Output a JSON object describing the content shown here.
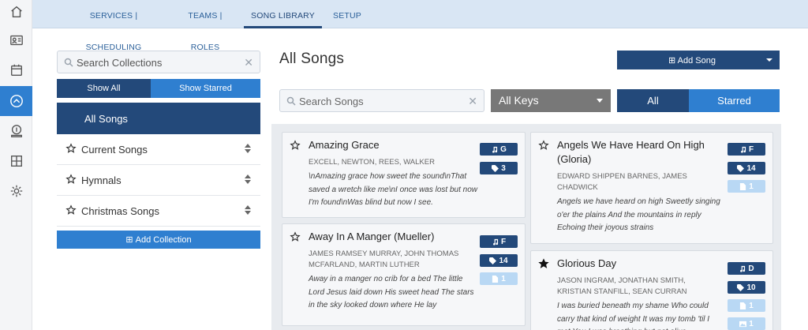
{
  "nav": {
    "tabs": [
      {
        "label": "SERVICES | SCHEDULING"
      },
      {
        "label": "TEAMS | ROLES"
      },
      {
        "label": "SONG LIBRARY"
      },
      {
        "label": "SETUP"
      }
    ]
  },
  "rail": [
    "home-icon",
    "contact-card-icon",
    "calendar-icon",
    "chevron-up-circle-icon",
    "money-icon",
    "grid-icon",
    "gear-icon"
  ],
  "collections": {
    "search_placeholder": "Search Collections",
    "show_all": "Show All",
    "show_starred": "Show Starred",
    "active": "All Songs",
    "items": [
      {
        "label": "Current Songs"
      },
      {
        "label": "Hymnals"
      },
      {
        "label": "Christmas Songs"
      }
    ],
    "add_label": "Add Collection"
  },
  "songs": {
    "title": "All Songs",
    "add_label": "Add Song",
    "search_placeholder": "Search Songs",
    "keys_label": "All Keys",
    "filter_all": "All",
    "filter_starred": "Starred",
    "list": [
      {
        "title": "Amazing Grace",
        "authors": "EXCELL, NEWTON, REES, WALKER",
        "lyrics": "\\nAmazing grace how sweet the sound\\nThat saved a wretch like me\\nI once was lost but now I'm found\\nWas blind but now I see.",
        "key": "G",
        "tags": "3",
        "starred": false
      },
      {
        "title": "Away In A Manger (Mueller)",
        "authors": "JAMES RAMSEY MURRAY, JOHN THOMAS MCFARLAND, MARTIN LUTHER",
        "lyrics": "Away in a manger no crib for a bed The little Lord Jesus laid down His sweet head The stars in the sky looked down where He lay",
        "key": "F",
        "tags": "14",
        "files": "1",
        "starred": false
      },
      {
        "title": "Angels We Have Heard On High (Gloria)",
        "authors": "EDWARD SHIPPEN BARNES, JAMES CHADWICK",
        "lyrics": "Angels we have heard on high Sweetly singing o'er the plains And the mountains in reply Echoing their joyous strains",
        "key": "F",
        "tags": "14",
        "files": "1",
        "starred": false
      },
      {
        "title": "Glorious Day",
        "authors": "JASON INGRAM, JONATHAN SMITH, KRISTIAN STANFILL, SEAN CURRAN",
        "lyrics": "I was buried beneath my shame Who could carry that kind of weight It was my tomb 'til I met You I was breathing but not alive",
        "key": "D",
        "tags": "10",
        "files": "1",
        "images": "1",
        "starred": true
      }
    ]
  }
}
